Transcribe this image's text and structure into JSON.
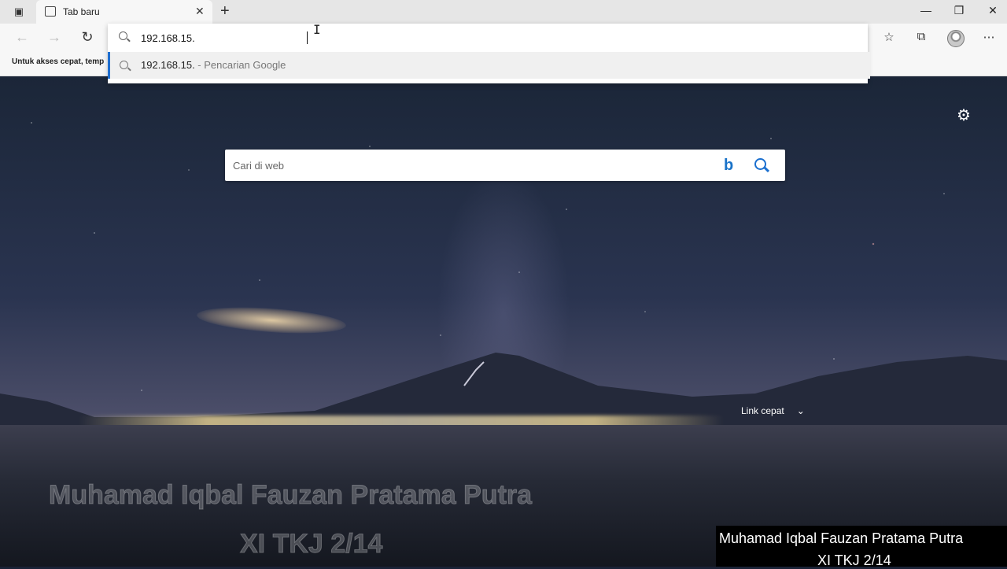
{
  "browser": {
    "tab": {
      "title": "Tab baru"
    },
    "bookmarks_bar_text": "Untuk akses cepat, temp",
    "address_bar": {
      "value": "192.168.15.",
      "suggestion_value": "192.168.15.",
      "suggestion_separator": " - ",
      "suggestion_hint": "Pencarian Google"
    },
    "icons": {
      "tab_actions": "▣",
      "new_tab": "+",
      "close": "✕",
      "back": "←",
      "forward": "→",
      "refresh": "↻",
      "minimize": "—",
      "restore": "❐",
      "window_close": "✕",
      "favorites": "☆",
      "collections": "⧉",
      "more": "⋯"
    }
  },
  "page": {
    "search": {
      "placeholder": "Cari di web",
      "bing_glyph": "b"
    },
    "settings_glyph": "⚙",
    "quick_links": {
      "label": "Link cepat",
      "chevron": "⌄"
    }
  },
  "overlay": {
    "watermark_name": "Muhamad Iqbal Fauzan Pratama Putra",
    "watermark_class": "XI TKJ 2/14",
    "caption_name": "Muhamad Iqbal Fauzan Pratama Putra",
    "caption_class": "XI TKJ 2/14"
  }
}
